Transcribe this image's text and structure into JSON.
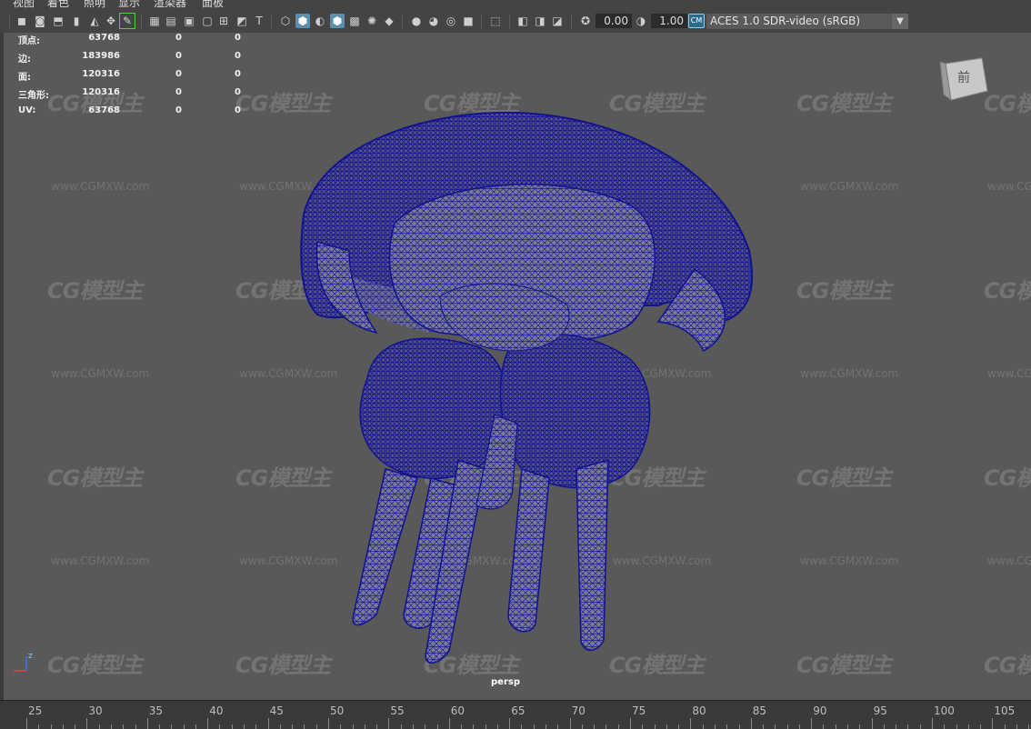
{
  "menu": [
    "视图",
    "着色",
    "照明",
    "显示",
    "渲染器",
    "面板"
  ],
  "toolbar": {
    "icons": [
      "camera-select-icon",
      "camera-attributes-icon",
      "bookmark-icon",
      "image-plane-icon",
      "grid-icon",
      "film-gate-icon",
      "resolution-gate-icon",
      "gate-mask-icon",
      "field-chart-icon",
      "safe-action-icon",
      "safe-title-icon",
      "wireframe-icon",
      "smooth-shade-icon",
      "use-default-material-icon",
      "wireframe-on-shaded-icon",
      "textured-icon",
      "lights-icon",
      "shadows-icon",
      "screen-space-ao-icon",
      "motion-blur-icon",
      "multisample-aa-icon",
      "depth-of-field-icon",
      "isolate-select-icon",
      "xray-icon",
      "xray-joints-icon",
      "xray-active-icon",
      "backface-culling-icon",
      "exposure-icon",
      "gamma-icon",
      "color-management-icon"
    ],
    "exposure_value": "0.00",
    "gamma_value": "1.00",
    "color_space_badge": "CM",
    "color_space": "ACES 1.0 SDR-video (sRGB)"
  },
  "hud": {
    "rows": [
      {
        "label": "顶点:",
        "v1": "63768",
        "v2": "0",
        "v3": "0"
      },
      {
        "label": "边:",
        "v1": "183986",
        "v2": "0",
        "v3": "0"
      },
      {
        "label": "面:",
        "v1": "120316",
        "v2": "0",
        "v3": "0"
      },
      {
        "label": "三角形:",
        "v1": "120316",
        "v2": "0",
        "v3": "0"
      },
      {
        "label": "UV:",
        "v1": "63768",
        "v2": "0",
        "v3": "0"
      }
    ]
  },
  "viewport": {
    "camera_label": "persp",
    "viewcube_label": "前",
    "axis_label": "Z",
    "watermark_logo": "CG模型主",
    "watermark_url": "www.CGMXW.com",
    "mesh_color": "#1a1aa8"
  },
  "timeline": {
    "ticks": [
      "25",
      "30",
      "35",
      "40",
      "45",
      "50",
      "55",
      "60",
      "65",
      "70",
      "75",
      "80",
      "85",
      "90",
      "95",
      "100",
      "105"
    ]
  }
}
